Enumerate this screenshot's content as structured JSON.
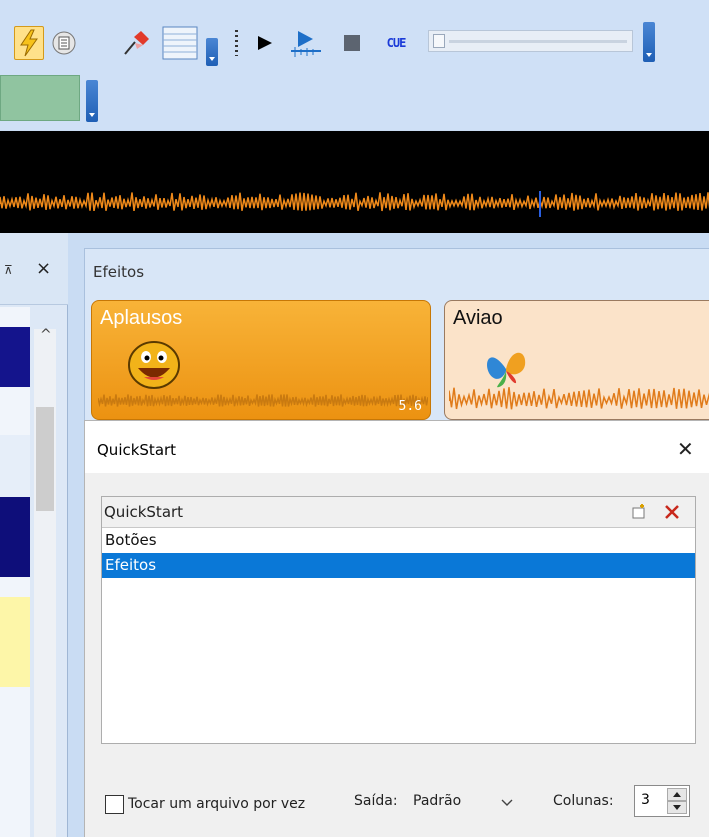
{
  "toolbar": {
    "icons": [
      "lightning-icon",
      "document-icon",
      "pin-icon",
      "grid-icon",
      "play-icon",
      "play-to-icon",
      "stop-icon",
      "cue-icon"
    ],
    "cue_label": "CUE",
    "colors": {
      "toolbar_bg": "#cfe0f6",
      "waveform": "#f08a1a",
      "green_swatch": "#90c4a0"
    }
  },
  "left_panel": {
    "pin_glyph": "⊼",
    "close_glyph": "×",
    "scroll_up_glyph": "^"
  },
  "effects_panel": {
    "title": "Efeitos",
    "pads": [
      {
        "label": "Aplausos",
        "duration": "5.6",
        "icon": "smiley-icon",
        "color": "#f5a11c"
      },
      {
        "label": "Aviao",
        "icon": "butterfly-icon",
        "color": "#fbe3c9"
      }
    ]
  },
  "dialog": {
    "title": "QuickStart",
    "close_glyph": "✕",
    "list_header": "QuickStart",
    "items": [
      {
        "label": "Botões",
        "selected": false
      },
      {
        "label": "Efeitos",
        "selected": true
      }
    ],
    "checkbox_label": "Tocar um arquivo por vez",
    "checkbox_checked": false,
    "output_label": "Saída:",
    "output_value": "Padrão",
    "columns_label": "Colunas:",
    "columns_value": "3"
  }
}
